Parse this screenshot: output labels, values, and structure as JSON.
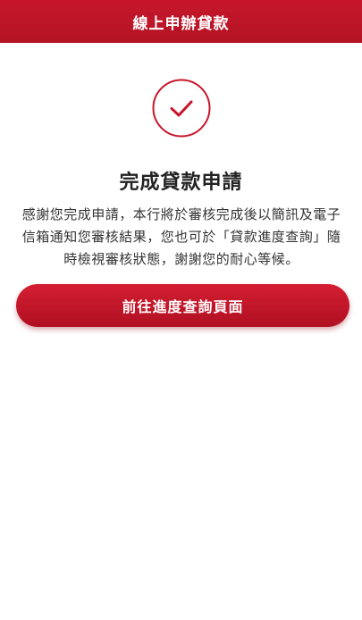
{
  "header": {
    "title": "線上申辦貸款"
  },
  "status": {
    "icon": "check-circle-icon",
    "accent_color": "#c7162b"
  },
  "content": {
    "title": "完成貸款申請",
    "message": "感謝您完成申請，本行將於審核完成後以簡訊及電子信箱通知您審核結果，您也可於「貸款進度查詢」隨時檢視審核狀態，謝謝您的耐心等候。"
  },
  "actions": {
    "primary_label": "前往進度查詢頁面"
  }
}
